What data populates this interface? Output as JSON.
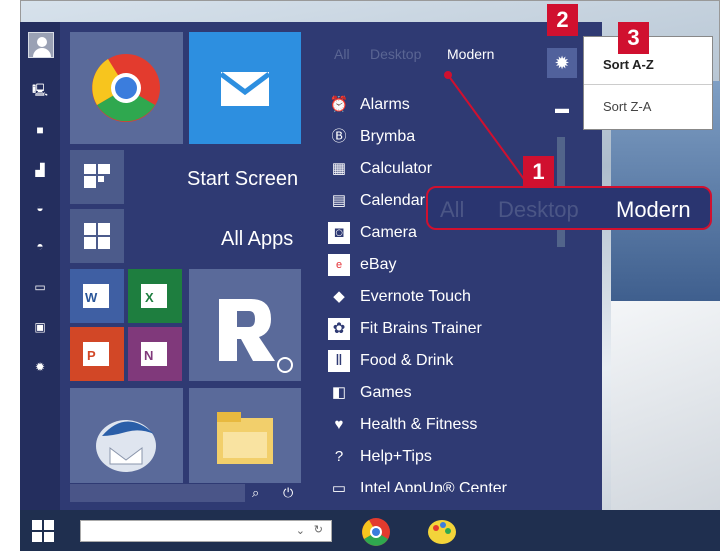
{
  "tiles": {
    "start_screen": "Start Screen",
    "all_apps": "All Apps"
  },
  "filters": {
    "all": "All",
    "desktop": "Desktop",
    "modern": "Modern"
  },
  "callout": {
    "all": "All",
    "desktop": "Desktop",
    "modern": "Modern"
  },
  "badges": {
    "b1": "1",
    "b2": "2",
    "b3": "3"
  },
  "sort_menu": {
    "a_z": "Sort A-Z",
    "z_a": "Sort Z-A"
  },
  "apps": [
    {
      "label": "Alarms",
      "icon": "alarm-icon"
    },
    {
      "label": "Brymba",
      "icon": "brymba-icon"
    },
    {
      "label": "Calculator",
      "icon": "calculator-icon"
    },
    {
      "label": "Calendar",
      "icon": "calendar-icon"
    },
    {
      "label": "Camera",
      "icon": "camera-icon"
    },
    {
      "label": "eBay",
      "icon": "ebay-icon"
    },
    {
      "label": "Evernote Touch",
      "icon": "evernote-icon"
    },
    {
      "label": "Fit Brains Trainer",
      "icon": "fit-brains-icon"
    },
    {
      "label": "Food & Drink",
      "icon": "food-drink-icon"
    },
    {
      "label": "Games",
      "icon": "games-icon"
    },
    {
      "label": "Health & Fitness",
      "icon": "health-icon"
    },
    {
      "label": "Help+Tips",
      "icon": "help-icon"
    },
    {
      "label": "Intel AppUp® Center",
      "icon": "intel-icon"
    }
  ],
  "colors": {
    "start_bg": "#2f3a73",
    "accent_red": "#d0102f",
    "mail_tile": "#2d8fe0"
  }
}
